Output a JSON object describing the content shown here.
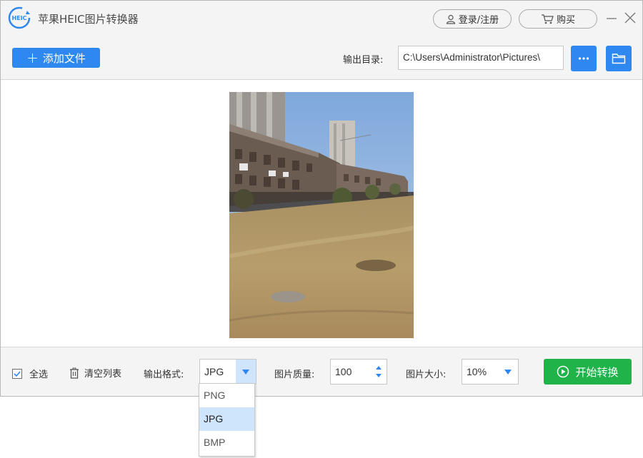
{
  "app": {
    "title": "苹果HEIC图片转换器",
    "logo_text": "HEIC"
  },
  "titlebar": {
    "login_label": "登录/注册",
    "buy_label": "购买"
  },
  "toolbar": {
    "add_file_label": "添加文件",
    "output_dir_label": "输出目录:",
    "output_dir_value": "C:\\Users\\Administrator\\Pictures\\"
  },
  "preview": {
    "icon": "photo-preview"
  },
  "bottom": {
    "select_all_label": "全选",
    "select_all_checked": true,
    "clear_list_label": "清空列表",
    "format_label": "输出格式:",
    "format_value": "JPG",
    "quality_label": "图片质量:",
    "quality_value": "100",
    "size_label": "图片大小:",
    "size_value": "10%",
    "start_label": "开始转换"
  },
  "format_dropdown": {
    "options": [
      "PNG",
      "JPG",
      "BMP"
    ],
    "selected": "JPG"
  },
  "colors": {
    "accent": "#2f88ef",
    "start": "#1fb34a",
    "selected_row": "#cfe5fb"
  }
}
